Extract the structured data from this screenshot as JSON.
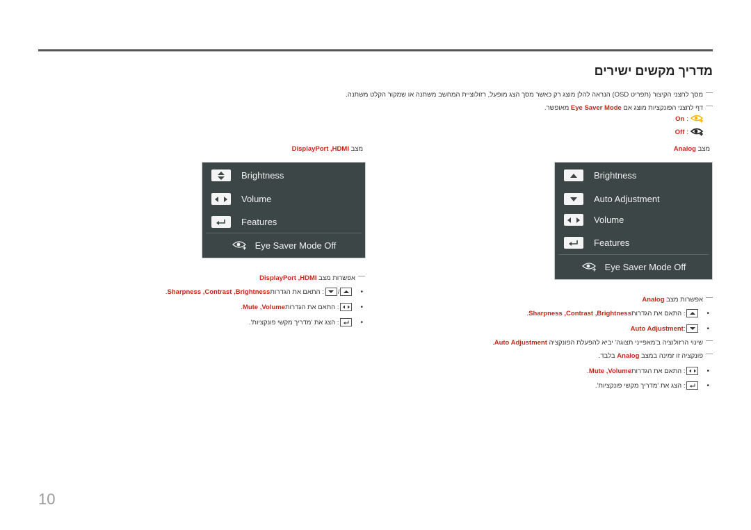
{
  "page": {
    "title": "מדריך מקשים ישירים",
    "page_number": "10"
  },
  "intro": {
    "note1": "מסך לחצני הקיצור (תפריט OSD) הנראה להלן מוצג רק כאשר מסך הצג מופעל, רזולוציית המחשב משתנה או שמקור הקלט משתנה.",
    "note2_prefix": "דף לחצני הפונקציות מוצג אם ",
    "note2_highlight": "Eye Saver Mode",
    "note2_suffix": " מאופשר.",
    "on_label": "On",
    "off_label": "Off",
    "on_icon": "eye-saver-on-icon",
    "off_icon": "eye-saver-off-icon",
    "on_color": "#f5b800",
    "off_color": "#222222"
  },
  "colors": {
    "highlight": "#c8261a",
    "osd_bg": "#3d4646",
    "rule": "#555555"
  },
  "left_panel": {
    "mode_prefix": "מצב ",
    "mode_value": "DisplayPort ,HDMI",
    "osd_items": [
      {
        "icon": "up-down-arrows-icon",
        "label": "Brightness"
      },
      {
        "icon": "left-right-arrows-icon",
        "label": "Volume"
      },
      {
        "icon": "enter-return-icon",
        "label": "Features"
      }
    ],
    "eye_saver_label": "Eye Saver Mode Off",
    "options_prefix": "אפשרות מצב ",
    "options_value": "DisplayPort ,HDMI",
    "bullets": [
      {
        "text_prefix": ": התאם את הגדרות ",
        "highlight": "Sharpness ,Contrast ,Brightness",
        "suffix": "."
      },
      {
        "text_prefix": ": התאם את הגדרות ",
        "highlight": "Mute ,Volume",
        "suffix": "."
      },
      {
        "text_prefix": ": הצג את 'מדריך מקשי פונקציות'.",
        "highlight": "",
        "suffix": ""
      }
    ]
  },
  "right_panel": {
    "mode_prefix": "מצב ",
    "mode_value": "Analog",
    "osd_items": [
      {
        "icon": "up-arrow-icon",
        "label": "Brightness"
      },
      {
        "icon": "down-arrow-icon",
        "label": "Auto Adjustment"
      },
      {
        "icon": "left-right-arrows-icon",
        "label": "Volume"
      },
      {
        "icon": "enter-return-icon",
        "label": "Features"
      }
    ],
    "eye_saver_label": "Eye Saver Mode Off",
    "options_prefix": "אפשרות מצב ",
    "options_value": "Analog",
    "bullets": [
      {
        "text_prefix": ": התאם את הגדרות ",
        "highlight": "Sharpness ,Contrast ,Brightness",
        "suffix": "."
      },
      {
        "text_prefix": ": ",
        "highlight": "Auto Adjustment",
        "suffix": ""
      },
      {
        "text_prefix": ": התאם את הגדרות ",
        "highlight": "Mute ,Volume",
        "suffix": "."
      },
      {
        "text_prefix": ": הצג את 'מדריך מקשי פונקציות'.",
        "highlight": "",
        "suffix": ""
      }
    ],
    "auto_note_prefix": "שינוי הרזולוציה ב'מאפייני תצוגה' יביא להפעלת הפונקציה ",
    "auto_note_highlight": "Auto Adjustment",
    "auto_note_suffix": ".",
    "analog_note_prefix": "פונקציה זו זמינה במצב ",
    "analog_note_highlight": "Analog",
    "analog_note_suffix": " בלבד."
  }
}
